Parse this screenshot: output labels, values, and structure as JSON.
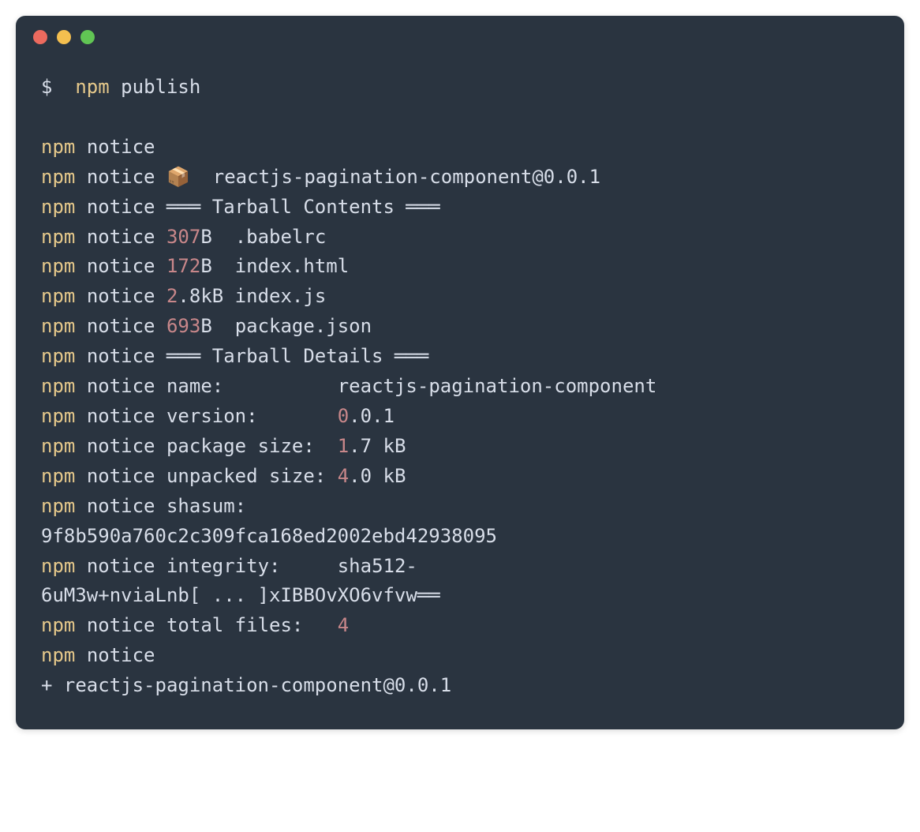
{
  "command": {
    "prompt": "$",
    "npm": "npm",
    "publish": "publish"
  },
  "prefix": {
    "npm": "npm",
    "notice": "notice"
  },
  "pkg_emoji": "📦",
  "pkg_full": "reactjs-pagination-component@0.0.1",
  "sections": {
    "tarball_contents": "═══ Tarball Contents ═══",
    "tarball_details": "═══ Tarball Details ═══"
  },
  "files": [
    {
      "size_num": "307",
      "size_unit": "B",
      "name": ".babelrc"
    },
    {
      "size_num": "172",
      "size_unit": "B",
      "name": "index.html"
    },
    {
      "size_num": "2",
      "size_dec": ".8kB",
      "name": "index.js"
    },
    {
      "size_num": "693",
      "size_unit": "B",
      "name": "package.json"
    }
  ],
  "details": {
    "name_label": "name:",
    "name_value": "reactjs-pagination-component",
    "version_label": "version:",
    "version_num": "0",
    "version_rest": ".0.1",
    "pkgsize_label": "package size:",
    "pkgsize_num": "1",
    "pkgsize_rest": ".7 kB",
    "unpacked_label": "unpacked size:",
    "unpacked_num": "4",
    "unpacked_rest": ".0 kB",
    "shasum_label": "shasum:",
    "shasum_value": "9f8b590a760c2c309fca168ed2002ebd42938095",
    "integrity_label": "integrity:",
    "integrity_prefix": "sha512-",
    "integrity_value": "6uM3w+nviaLnb[ ... ]xIBBOvXO6vfvw══",
    "total_label": "total files:",
    "total_value": "4"
  },
  "final_plus": "+",
  "final_pkg": "reactjs-pagination-component@0.0.1"
}
